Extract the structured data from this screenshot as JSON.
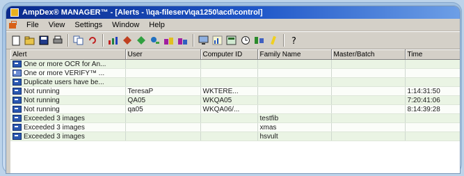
{
  "window": {
    "title": "AmpDex® MANAGER™ - [Alerts - \\\\qa-fileserv\\qa1250\\acd\\control]"
  },
  "menu": [
    "File",
    "View",
    "Settings",
    "Window",
    "Help"
  ],
  "toolbar": {
    "icons": [
      "new-document-icon",
      "open-folder-icon",
      "save-icon",
      "print-icon",
      "copy-icon",
      "undo-icon",
      "chart-icon",
      "move-icon",
      "diamond-icon",
      "search-people-icon",
      "users-icon",
      "users-alt-icon",
      "monitor-icon",
      "bar-chart-icon",
      "report-icon",
      "clock-icon",
      "tool-icon",
      "highlighter-icon",
      "help-icon"
    ]
  },
  "table": {
    "columns": [
      "Alert",
      "User",
      "Computer ID",
      "Family Name",
      "Master/Batch",
      "Time"
    ],
    "rows": [
      {
        "icon": "alert-icon",
        "alert": "One or more OCR for An...",
        "user": "",
        "computer": "",
        "family": "",
        "batch": "",
        "time": ""
      },
      {
        "icon": "document-alert-icon",
        "alert": "One or more VERIFY™ ...",
        "user": "",
        "computer": "",
        "family": "",
        "batch": "",
        "time": ""
      },
      {
        "icon": "alert-icon",
        "alert": "Duplicate users have be...",
        "user": "",
        "computer": "",
        "family": "",
        "batch": "",
        "time": ""
      },
      {
        "icon": "alert-icon",
        "alert": "Not running",
        "user": "TeresaP",
        "computer": "WKTERE...",
        "family": "",
        "batch": "",
        "time": "1:14:31:50"
      },
      {
        "icon": "alert-icon",
        "alert": "Not running",
        "user": "QA05",
        "computer": "WKQA05",
        "family": "",
        "batch": "",
        "time": "7:20:41:06"
      },
      {
        "icon": "alert-icon",
        "alert": "Not running",
        "user": "qa05",
        "computer": "WKQA06/...",
        "family": "",
        "batch": "",
        "time": "8:14:39:28"
      },
      {
        "icon": "alert-icon",
        "alert": "Exceeded 3 images",
        "user": "",
        "computer": "",
        "family": "testfib",
        "batch": "",
        "time": ""
      },
      {
        "icon": "alert-icon",
        "alert": "Exceeded 3 images",
        "user": "",
        "computer": "",
        "family": "xmas",
        "batch": "",
        "time": ""
      },
      {
        "icon": "alert-icon",
        "alert": "Exceeded 3 images",
        "user": "",
        "computer": "",
        "family": "hsvult",
        "batch": "",
        "time": ""
      }
    ]
  }
}
